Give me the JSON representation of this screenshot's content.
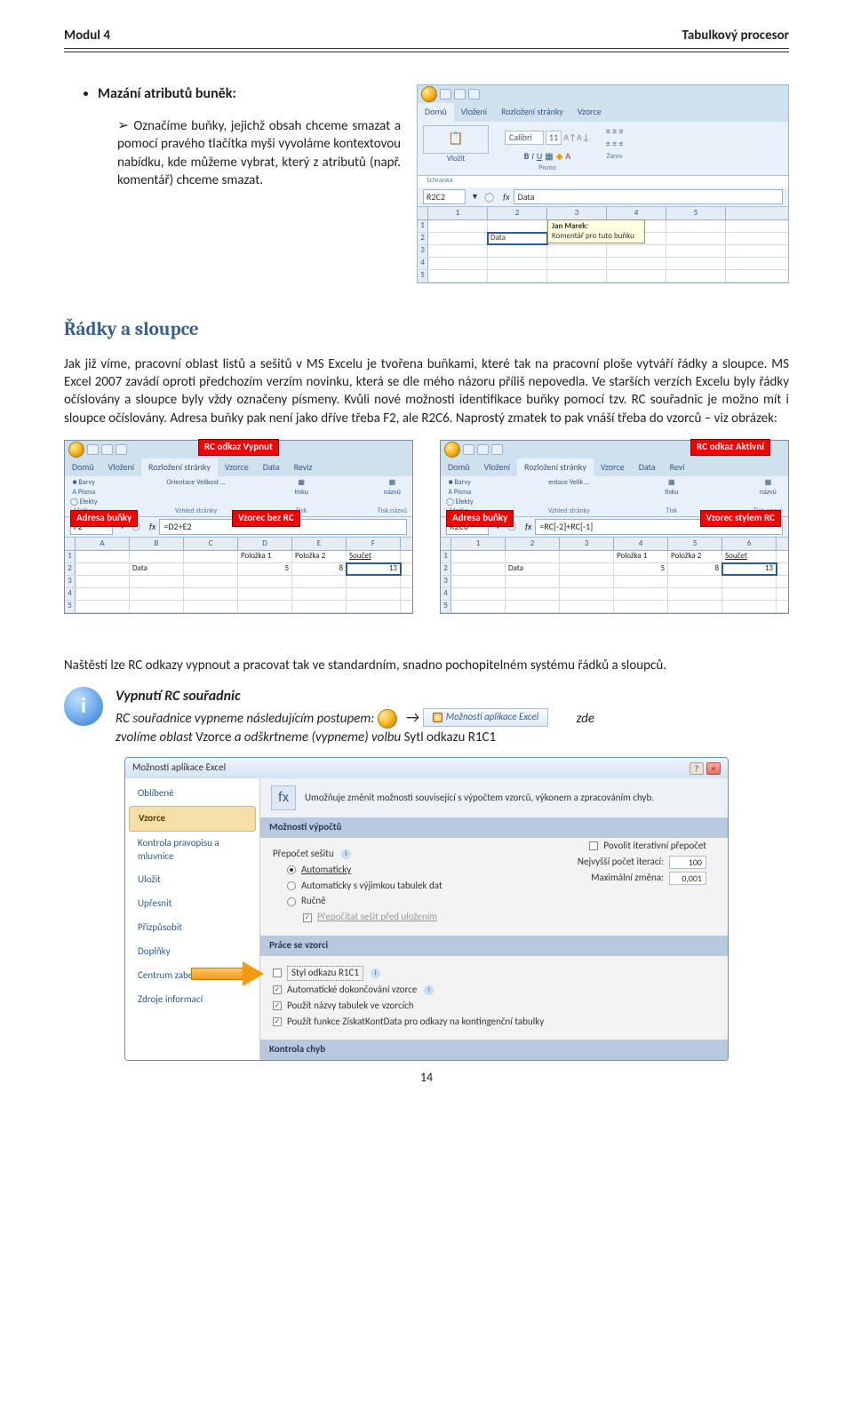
{
  "header": {
    "left": "Modul 4",
    "right": "Tabulkový procesor"
  },
  "bullet1": "Mazání atributů buněk:",
  "bullet2": "Označíme buňky, jejichž obsah chceme smazat a pomocí pravého tlačítka myši vyvoláme kontextovou nabídku, kde můžeme vybrat, který z atributů (např. komentář) chceme smazat.",
  "topshot": {
    "tabs": [
      "Domů",
      "Vložení",
      "Rozložení stránky",
      "Vzorce"
    ],
    "rib": {
      "paste": "Vložit",
      "clipboard": "Schránka",
      "font": "Písmo",
      "zar": "Zarov",
      "fontname": "Calibri",
      "fontsize": "11"
    },
    "namebox": "R2C2",
    "fxval": "Data",
    "cols": [
      "1",
      "2",
      "3",
      "4",
      "5"
    ],
    "r2c2": "Data",
    "tip_author": "Jan Marek:",
    "tip_text": "Komentář pro tuto buňku"
  },
  "sectionTitle": "Řádky a sloupce",
  "para1": "Jak již víme, pracovní oblast listů a sešitů v MS Excelu je tvořena buňkami, které tak na pracovní ploše vytváří řádky a sloupce. MS Excel 2007 zavádí oproti předchozím verzím novinku, která se dle mého názoru příliš nepovedla. Ve starších verzích Excelu byly řádky očíslovány a sloupce byly vždy označeny písmeny. Kvůli nové možnosti identifikace buňky pomocí tzv. RC souřadnic je možno mít i sloupce očíslovány. Adresa buňky pak není jako dříve třeba F2, ale R2C6. Naprostý zmatek to pak vnáší třeba do vzorců – viz obrázek:",
  "tags": {
    "off": "RC odkaz Vypnut",
    "on": "RC odkaz Aktivní",
    "addr": "Adresa buňky",
    "f_off": "Vzorec bez RC",
    "f_on": "Vzorec stylem RC"
  },
  "left": {
    "tabs": [
      "Domů",
      "Vložení",
      "Rozložení stránky",
      "Vzorce",
      "Data",
      "Reviz"
    ],
    "groups": [
      "Motivy",
      "Vzhled stránky",
      "Tisk",
      "Tisk názvů"
    ],
    "sub": [
      "Barvy",
      "Písma",
      "Efekty",
      "Orientace",
      "Velikost",
      "",
      "názvů"
    ],
    "namebox": "F2",
    "fx": "=D2+E2",
    "cols": [
      "A",
      "B",
      "C",
      "D",
      "E",
      "F"
    ],
    "hdr4": "Položka 1",
    "hdr5": "Položka 2",
    "hdr6": "Součet",
    "r2b": "Data",
    "r2d": "5",
    "r2e": "8",
    "r2f": "13"
  },
  "right": {
    "tabs": [
      "Domů",
      "Vložení",
      "Rozložení stránky",
      "Vzorce",
      "Data",
      "Revi"
    ],
    "groups": [
      "Motivy",
      "Vzhled stránky",
      "Tisk",
      "Tisk názvů"
    ],
    "namebox": "R2C6",
    "fx": "=RC[-2]+RC[-1]",
    "cols": [
      "1",
      "2",
      "3",
      "4",
      "5",
      "6"
    ],
    "hdr4": "Položka 1",
    "hdr5": "Položka 2",
    "hdr6": "Součet",
    "r2b": "Data",
    "r2d": "5",
    "r2e": "8",
    "r2f": "13"
  },
  "para2": "Naštěstí lze RC odkazy vypnout a pracovat tak ve standardním, snadno pochopitelném systému řádků a sloupců.",
  "info": {
    "title": "Vypnutí RC souřadnic",
    "line_a": "RC souřadnice vypneme následujícím postupem:",
    "arrow": "→",
    "btn": "Možnosti aplikace Excel",
    "zde": "zde",
    "line_b_a": "zvolíme oblast ",
    "line_b_b": "Vzorce",
    "line_b_c": " a odškrtneme (vypneme) volbu ",
    "line_b_d": "Sytl odkazu R1C1"
  },
  "dialog": {
    "title": "Možnosti aplikace Excel",
    "side": [
      "Oblíbené",
      "Vzorce",
      "Kontrola pravopisu a mluvnice",
      "Uložit",
      "Upřesnit",
      "Přizpůsobit",
      "Doplňky",
      "Centrum zabezpečení",
      "Zdroje informací"
    ],
    "desc": "Umožňuje změnit možnosti související s výpočtem vzorců, výkonem a zpracováním chyb.",
    "cat1": "Možnosti výpočtů",
    "recalc": "Přepočet sešitu",
    "r1": "Automaticky",
    "r2": "Automaticky s výjimkou tabulek dat",
    "r3": "Ručně",
    "r3sub": "Přepočítat sešit před uložením",
    "iter": "Povolit iterativní přepočet",
    "iter_a": "Nejvyšší počet iterací:",
    "iter_a_v": "100",
    "iter_b": "Maximální změna:",
    "iter_b_v": "0,001",
    "cat2": "Práce se vzorci",
    "s1": "Styl odkazu R1C1",
    "s2": "Automatické dokončování vzorce",
    "s3": "Použít názvy tabulek ve vzorcích",
    "s4": "Použít funkce ZískatKontData pro odkazy na kontingenční tabulky",
    "cat3": "Kontrola chyb"
  },
  "pagenum": "14"
}
